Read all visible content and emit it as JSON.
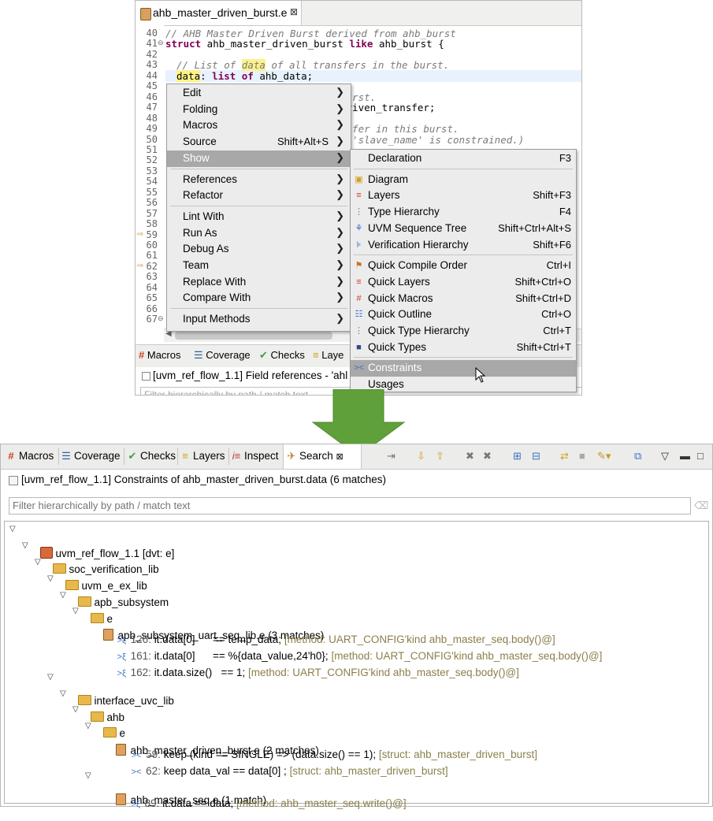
{
  "editor": {
    "tab_title": "ahb_master_driven_burst.e",
    "tab_close": "⊠",
    "lines": [
      {
        "n": "40",
        "text": "// AHB Master Driven Burst derived from ahb_burst"
      },
      {
        "n": "41",
        "text": "struct ahb_master_driven_burst like ahb_burst {"
      },
      {
        "n": "42",
        "text": ""
      },
      {
        "n": "43",
        "text": "// List of data of all transfers in the burst."
      },
      {
        "n": "44",
        "text": "data: list of ahb_data;"
      },
      {
        "n": "45",
        "text": ""
      },
      {
        "n": "46",
        "text": "burst."
      },
      {
        "n": "47",
        "text": "driven_transfer;"
      },
      {
        "n": "48",
        "text": ""
      },
      {
        "n": "49",
        "text": "nsfer in this burst."
      },
      {
        "n": "50",
        "text": "f 'slave_name' is constrained.)"
      },
      {
        "n": "51",
        "text": ""
      },
      {
        "n": "52",
        "text": ""
      },
      {
        "n": "53",
        "text": ""
      },
      {
        "n": "54",
        "text": ""
      },
      {
        "n": "55",
        "text": ""
      },
      {
        "n": "56",
        "text": ""
      },
      {
        "n": "57",
        "text": ""
      },
      {
        "n": "58",
        "text": ""
      },
      {
        "n": "59",
        "text": ""
      },
      {
        "n": "60",
        "text": ""
      },
      {
        "n": "61",
        "text": ""
      },
      {
        "n": "62",
        "text": ""
      },
      {
        "n": "63",
        "text": ""
      },
      {
        "n": "64",
        "text": ""
      },
      {
        "n": "65",
        "text": ""
      },
      {
        "n": "66",
        "text": ""
      },
      {
        "n": "67",
        "text": ""
      }
    ],
    "mini_tabs": [
      "Macros",
      "Coverage",
      "Checks",
      "Laye"
    ],
    "mini_status": "[uvm_ref_flow_1.1] Field references - 'ahl",
    "mini_filter": "Filter hierarchically by path / match text"
  },
  "context_menu": {
    "items": [
      {
        "label": "Edit",
        "shortcut": ""
      },
      {
        "label": "Folding",
        "shortcut": ""
      },
      {
        "label": "Macros",
        "shortcut": ""
      },
      {
        "label": "Source",
        "shortcut": "Shift+Alt+S"
      },
      {
        "label": "Show",
        "shortcut": ""
      },
      {
        "label": "References",
        "shortcut": ""
      },
      {
        "label": "Refactor",
        "shortcut": ""
      },
      {
        "label": "Lint With",
        "shortcut": ""
      },
      {
        "label": "Run As",
        "shortcut": ""
      },
      {
        "label": "Debug As",
        "shortcut": ""
      },
      {
        "label": "Team",
        "shortcut": ""
      },
      {
        "label": "Replace With",
        "shortcut": ""
      },
      {
        "label": "Compare With",
        "shortcut": ""
      },
      {
        "label": "Input Methods",
        "shortcut": ""
      }
    ]
  },
  "show_submenu": {
    "items": [
      {
        "label": "Declaration",
        "shortcut": "F3",
        "icon": "none"
      },
      {
        "label": "Diagram",
        "shortcut": "",
        "icon": "diagram-icon"
      },
      {
        "label": "Layers",
        "shortcut": "Shift+F3",
        "icon": "layers-icon"
      },
      {
        "label": "Type Hierarchy",
        "shortcut": "F4",
        "icon": "type-hierarchy-icon"
      },
      {
        "label": "UVM Sequence Tree",
        "shortcut": "Shift+Ctrl+Alt+S",
        "icon": "uvm-tree-icon"
      },
      {
        "label": "Verification Hierarchy",
        "shortcut": "Shift+F6",
        "icon": "verification-hierarchy-icon"
      },
      {
        "label": "Quick Compile Order",
        "shortcut": "Ctrl+I",
        "icon": "compile-order-icon"
      },
      {
        "label": "Quick Layers",
        "shortcut": "Shift+Ctrl+O",
        "icon": "layers-icon"
      },
      {
        "label": "Quick Macros",
        "shortcut": "Shift+Ctrl+D",
        "icon": "macros-icon"
      },
      {
        "label": "Quick Outline",
        "shortcut": "Ctrl+O",
        "icon": "outline-icon"
      },
      {
        "label": "Quick Type Hierarchy",
        "shortcut": "Ctrl+T",
        "icon": "type-hierarchy-icon"
      },
      {
        "label": "Quick Types",
        "shortcut": "Shift+Ctrl+T",
        "icon": "types-icon"
      },
      {
        "label": "Constraints",
        "shortcut": "",
        "icon": "constraints-icon"
      },
      {
        "label": "Usages",
        "shortcut": "",
        "icon": "none"
      }
    ]
  },
  "search_view": {
    "tabs": [
      "Macros",
      "Coverage",
      "Checks",
      "Layers",
      "Inspect",
      "Search"
    ],
    "summary": "[uvm_ref_flow_1.1] Constraints of ahb_master_driven_burst.data (6 matches)",
    "filter_placeholder": "Filter hierarchically by path / match text",
    "tree": {
      "project": "uvm_ref_flow_1.1 [dvt: e]",
      "soc_lib": "soc_verification_lib",
      "uvm_e_ex_lib": "uvm_e_ex_lib",
      "apb_subsystem": "apb_subsystem",
      "e1": "e",
      "apb_file": "apb_subsystem_uart_seq_lib.e (3 matches)",
      "apb_m1": {
        "line": "126:",
        "code": "it.data[0]      == temp_data;",
        "ctx": "[method: UART_CONFIG'kind ahb_master_seq.body()@]"
      },
      "apb_m2": {
        "line": "161:",
        "code": "it.data[0]      == %{data_value,24'h0};",
        "ctx": "[method: UART_CONFIG'kind ahb_master_seq.body()@]"
      },
      "apb_m3": {
        "line": "162:",
        "code": "it.data.size()   == 1;",
        "ctx": "[method: UART_CONFIG'kind ahb_master_seq.body()@]"
      },
      "interface_lib": "interface_uvc_lib",
      "ahb": "ahb",
      "e2": "e",
      "burst_file": "ahb_master_driven_burst.e (2 matches)",
      "burst_m1": {
        "line": "59:",
        "code": "keep (kind == SINGLE) => (data.size() == 1);",
        "ctx": "[struct: ahb_master_driven_burst]"
      },
      "burst_m2": {
        "line": "62:",
        "code": "keep data_val == data[0] ;",
        "ctx": "[struct: ahb_master_driven_burst]"
      },
      "seq_file": "ahb_master_seq.e (1 match)",
      "seq_m1": {
        "line": "89:",
        "code": "it.data == data;",
        "ctx": "[method: ahb_master_seq.write()@]"
      }
    }
  },
  "colors": {
    "arrow_fill": "#5fa03a",
    "menu_selection": "#a8a8a8",
    "context_text": "#8b7f4a"
  }
}
